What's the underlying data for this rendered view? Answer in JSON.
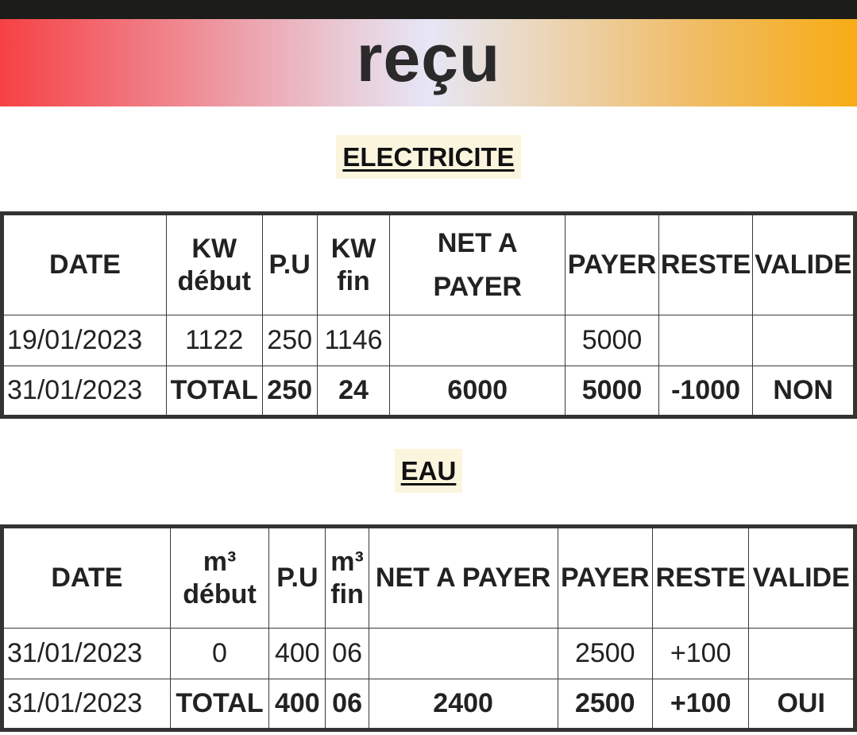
{
  "header": {
    "title": "reçu"
  },
  "electricite": {
    "section_label": "ELECTRICITE",
    "headers": {
      "date": "DATE",
      "debut_unit": "KW",
      "debut_word": "début",
      "pu": "P.U",
      "fin_unit": "KW",
      "fin_word": "fin",
      "net_line1": "NET A",
      "net_line2": "PAYER",
      "payer": "PAYER",
      "reste": "RESTE",
      "valide": "VALIDE"
    },
    "rows": [
      {
        "date": "19/01/2023",
        "debut": "1122",
        "pu": "250",
        "fin": "1146",
        "net": "",
        "payer": "5000",
        "reste": "",
        "valide": ""
      },
      {
        "date": "31/01/2023",
        "debut": "TOTAL",
        "pu": "250",
        "fin": "24",
        "net": "6000",
        "payer": "5000",
        "reste": "-1000",
        "valide": "NON"
      }
    ]
  },
  "eau": {
    "section_label": "EAU",
    "headers": {
      "date": "DATE",
      "debut_unit": "m³",
      "debut_word": "début",
      "pu": "P.U",
      "fin_unit": "m³",
      "fin_word": "fin",
      "net": "NET A PAYER",
      "payer": "PAYER",
      "reste": "RESTE",
      "valide": "VALIDE"
    },
    "rows": [
      {
        "date": "31/01/2023",
        "debut": "0",
        "pu": "400",
        "fin": "06",
        "net": "",
        "payer": "2500",
        "reste": "+100",
        "valide": ""
      },
      {
        "date": "31/01/2023",
        "debut": "TOTAL",
        "pu": "400",
        "fin": "06",
        "net": "2400",
        "payer": "2500",
        "reste": "+100",
        "valide": "OUI"
      }
    ]
  }
}
